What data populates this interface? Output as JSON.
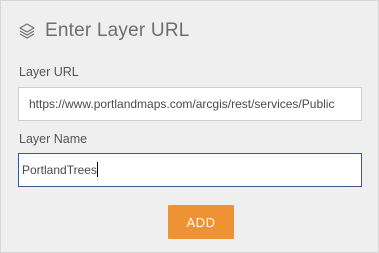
{
  "dialog": {
    "title": "Enter Layer URL",
    "title_icon": "layers-icon"
  },
  "fields": {
    "url": {
      "label": "Layer URL",
      "value": "https://www.portlandmaps.com/arcgis/rest/services/Public"
    },
    "name": {
      "label": "Layer Name",
      "value": "PortlandTrees"
    }
  },
  "actions": {
    "add_label": "ADD"
  },
  "colors": {
    "panel_background": "#efefef",
    "button_accent": "#ef9233",
    "focused_border": "#3b5b8e"
  }
}
